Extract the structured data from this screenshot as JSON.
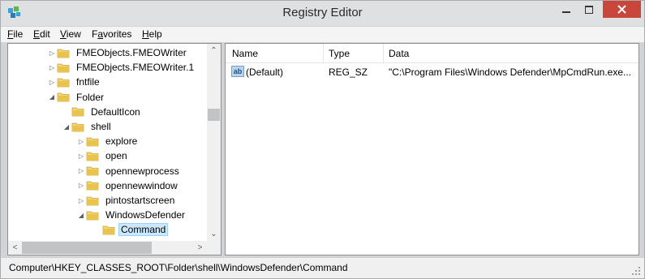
{
  "window": {
    "title": "Registry Editor"
  },
  "menu": [
    "File",
    "Edit",
    "View",
    "Favorites",
    "Help"
  ],
  "menu_underline": [
    "F",
    "E",
    "V",
    "a",
    "H"
  ],
  "tree": {
    "items": [
      {
        "label": "FMEObjects.FMEOWriter",
        "expander": "collapsed"
      },
      {
        "label": "FMEObjects.FMEOWriter.1",
        "expander": "collapsed"
      },
      {
        "label": "fntfile",
        "expander": "collapsed"
      },
      {
        "label": "Folder",
        "expander": "expanded"
      },
      {
        "label": "DefaultIcon",
        "expander": "none"
      },
      {
        "label": "shell",
        "expander": "expanded"
      },
      {
        "label": "explore",
        "expander": "collapsed"
      },
      {
        "label": "open",
        "expander": "collapsed"
      },
      {
        "label": "opennewprocess",
        "expander": "collapsed"
      },
      {
        "label": "opennewwindow",
        "expander": "collapsed"
      },
      {
        "label": "pintostartscreen",
        "expander": "collapsed"
      },
      {
        "label": "WindowsDefender",
        "expander": "expanded"
      },
      {
        "label": "Command",
        "expander": "none",
        "selected": true
      }
    ]
  },
  "list": {
    "columns": [
      "Name",
      "Type",
      "Data"
    ],
    "rows": [
      {
        "icon": "ab-string-icon",
        "name": "(Default)",
        "type": "REG_SZ",
        "data": "\"C:\\Program Files\\Windows Defender\\MpCmdRun.exe..."
      }
    ]
  },
  "status": {
    "path": "Computer\\HKEY_CLASSES_ROOT\\Folder\\shell\\WindowsDefender\\Command"
  },
  "colors": {
    "close_button": "#c9473a",
    "selection_bg": "#cce8ff",
    "folder": "#e8c44f"
  }
}
